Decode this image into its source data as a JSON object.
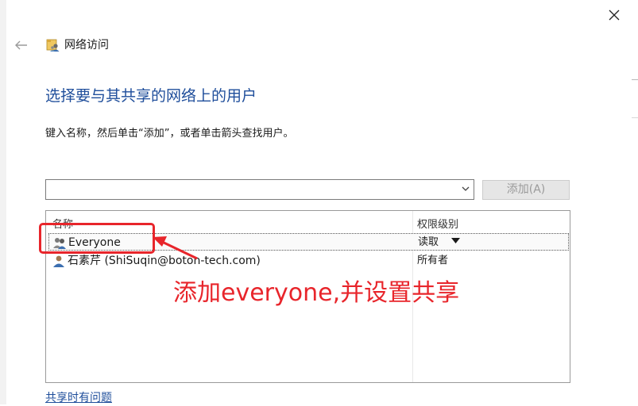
{
  "window": {
    "title": "网络访问",
    "close_icon": "close-icon",
    "back_icon": "back-arrow-icon"
  },
  "main": {
    "heading": "选择要与其共享的网络上的用户",
    "instruction": "键入名称，然后单击“添加”，或者单击箭头查找用户。",
    "name_input": {
      "value": "",
      "placeholder": ""
    },
    "add_button": {
      "label": "添加(A)",
      "enabled": false
    }
  },
  "table": {
    "columns": [
      "名称",
      "权限级别"
    ],
    "rows": [
      {
        "name": "Everyone",
        "permission": "读取",
        "has_dropdown": true,
        "selected": true
      },
      {
        "name": "石素芹 (ShiSuqin@boton-tech.com)",
        "permission": "所有者",
        "has_dropdown": false,
        "selected": false
      }
    ]
  },
  "annotation": {
    "text": "添加everyone,并设置共享",
    "color": "#e8252b"
  },
  "footer": {
    "help_link": "共享时有问题"
  },
  "colors": {
    "heading_blue": "#1f4e9b",
    "annotation_red": "#e8252b"
  }
}
